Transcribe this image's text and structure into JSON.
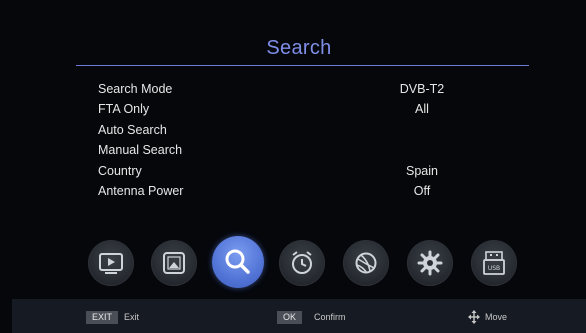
{
  "header": {
    "title": "Search"
  },
  "menu": {
    "items": [
      {
        "label": "Search Mode",
        "value": "DVB-T2"
      },
      {
        "label": "FTA Only",
        "value": "All"
      },
      {
        "label": "Auto Search",
        "value": ""
      },
      {
        "label": "Manual Search",
        "value": ""
      },
      {
        "label": "Country",
        "value": "Spain"
      },
      {
        "label": "Antenna Power",
        "value": "Off"
      }
    ]
  },
  "icon_bar": {
    "icons": [
      {
        "name": "tv-icon"
      },
      {
        "name": "picture-icon"
      },
      {
        "name": "search-icon",
        "selected": true
      },
      {
        "name": "alarm-clock-icon"
      },
      {
        "name": "globe-icon"
      },
      {
        "name": "settings-gear-icon"
      },
      {
        "name": "usb-icon"
      }
    ],
    "selected_color": "#5a7be0"
  },
  "footer": {
    "exit_key": "EXIT",
    "exit_label": "Exit",
    "ok_key": "OK",
    "ok_label": "Confirm",
    "move_label": "Move"
  },
  "colors": {
    "accent": "#7f8ee8",
    "background": "#05070b"
  }
}
